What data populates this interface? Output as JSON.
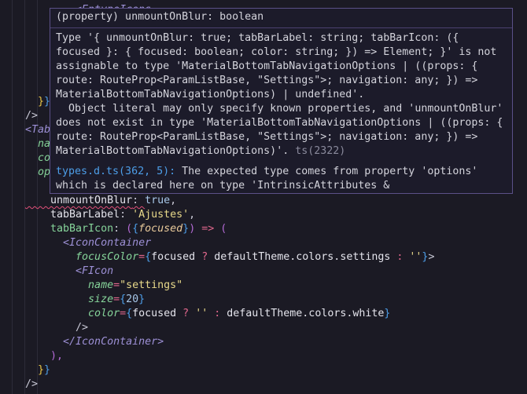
{
  "editor": {
    "first_line": [
      {
        "t": "        <EntypoIcons",
        "c": "tag"
      }
    ],
    "lines": [
      [
        {
          "t": "  }",
          "c": "brace2"
        },
        {
          "t": "}",
          "c": "brace"
        }
      ],
      [
        {
          "t": "/>",
          "c": "punc"
        }
      ],
      [
        {
          "t": "<Tab",
          "c": "tag"
        }
      ],
      [
        {
          "t": "  na",
          "c": "attr"
        }
      ],
      [
        {
          "t": "  co",
          "c": "attr"
        }
      ],
      [
        {
          "t": "  op",
          "c": "attr"
        }
      ],
      [],
      [
        {
          "t": "    unmountOnBlur",
          "c": "prop err"
        },
        {
          "t": ": ",
          "c": "punc err"
        },
        {
          "t": "true",
          "c": "bool"
        },
        {
          "t": ",",
          "c": "punc"
        }
      ],
      [
        {
          "t": "    tabBarLabel",
          "c": "prop"
        },
        {
          "t": ": ",
          "c": "punc"
        },
        {
          "t": "'Ajustes'",
          "c": "str"
        },
        {
          "t": ",",
          "c": "punc"
        }
      ],
      [
        {
          "t": "    tabBarIcon",
          "c": "propg"
        },
        {
          "t": ": ",
          "c": "punc"
        },
        {
          "t": "(",
          "c": "paren"
        },
        {
          "t": "{",
          "c": "brace"
        },
        {
          "t": "focused",
          "c": "param"
        },
        {
          "t": "}",
          "c": "brace"
        },
        {
          "t": ")",
          "c": "paren"
        },
        {
          "t": " => ",
          "c": "op"
        },
        {
          "t": "(",
          "c": "paren"
        }
      ],
      [
        {
          "t": "      <IconContainer",
          "c": "tag"
        }
      ],
      [
        {
          "t": "        focusColor",
          "c": "attr"
        },
        {
          "t": "=",
          "c": "op"
        },
        {
          "t": "{",
          "c": "brace"
        },
        {
          "t": "focused ",
          "c": "prop"
        },
        {
          "t": "?",
          "c": "op"
        },
        {
          "t": " defaultTheme.colors.settings ",
          "c": "prop"
        },
        {
          "t": ":",
          "c": "op"
        },
        {
          "t": " ''",
          "c": "str"
        },
        {
          "t": "}",
          "c": "brace"
        },
        {
          "t": ">",
          "c": "punc"
        }
      ],
      [
        {
          "t": "        <FIcon",
          "c": "tag"
        }
      ],
      [
        {
          "t": "          name",
          "c": "attr"
        },
        {
          "t": "=",
          "c": "op"
        },
        {
          "t": "\"settings\"",
          "c": "str"
        }
      ],
      [
        {
          "t": "          size",
          "c": "attr"
        },
        {
          "t": "=",
          "c": "op"
        },
        {
          "t": "{",
          "c": "brace"
        },
        {
          "t": "20",
          "c": "num"
        },
        {
          "t": "}",
          "c": "brace"
        }
      ],
      [
        {
          "t": "          color",
          "c": "attr"
        },
        {
          "t": "=",
          "c": "op"
        },
        {
          "t": "{",
          "c": "brace"
        },
        {
          "t": "focused ",
          "c": "prop"
        },
        {
          "t": "?",
          "c": "op"
        },
        {
          "t": " '' ",
          "c": "str"
        },
        {
          "t": ":",
          "c": "op"
        },
        {
          "t": " defaultTheme.colors.white",
          "c": "prop"
        },
        {
          "t": "}",
          "c": "brace"
        }
      ],
      [
        {
          "t": "        />",
          "c": "punc"
        }
      ],
      [
        {
          "t": "      </IconContainer>",
          "c": "tag"
        }
      ],
      [
        {
          "t": "    ),",
          "c": "paren"
        }
      ],
      [
        {
          "t": "  }",
          "c": "brace2"
        },
        {
          "t": "}",
          "c": "brace"
        }
      ],
      [
        {
          "t": "/>",
          "c": "punc"
        }
      ]
    ]
  },
  "tooltip": {
    "signature": "(property) unmountOnBlur: boolean",
    "message": "Type '{ unmountOnBlur: true; tabBarLabel: string; tabBarIcon: ({\nfocused }: { focused: boolean; color: string; }) => Element; }' is not\nassignable to type 'MaterialBottomTabNavigationOptions | ((props: {\nroute: RouteProp<ParamListBase, \"Settings\">; navigation: any; }) =>\nMaterialBottomTabNavigationOptions) | undefined'.\n  Object literal may only specify known properties, and 'unmountOnBlur'\ndoes not exist in type 'MaterialBottomTabNavigationOptions | ((props: {\nroute: RouteProp<ParamListBase, \"Settings\">; navigation: any; }) =>\nMaterialBottomTabNavigationOptions)'.",
    "error_code": "ts(2322)",
    "related_link": "types.d.ts(362, 5):",
    "related_text": " The expected type comes from property 'options'\nwhich is declared here on type 'IntrinsicAttributes &"
  },
  "colors": {
    "background": "#1b1a24",
    "tooltip_border": "#5b5088",
    "error_squiggle": "#e0507a",
    "link": "#4d9ee8"
  }
}
